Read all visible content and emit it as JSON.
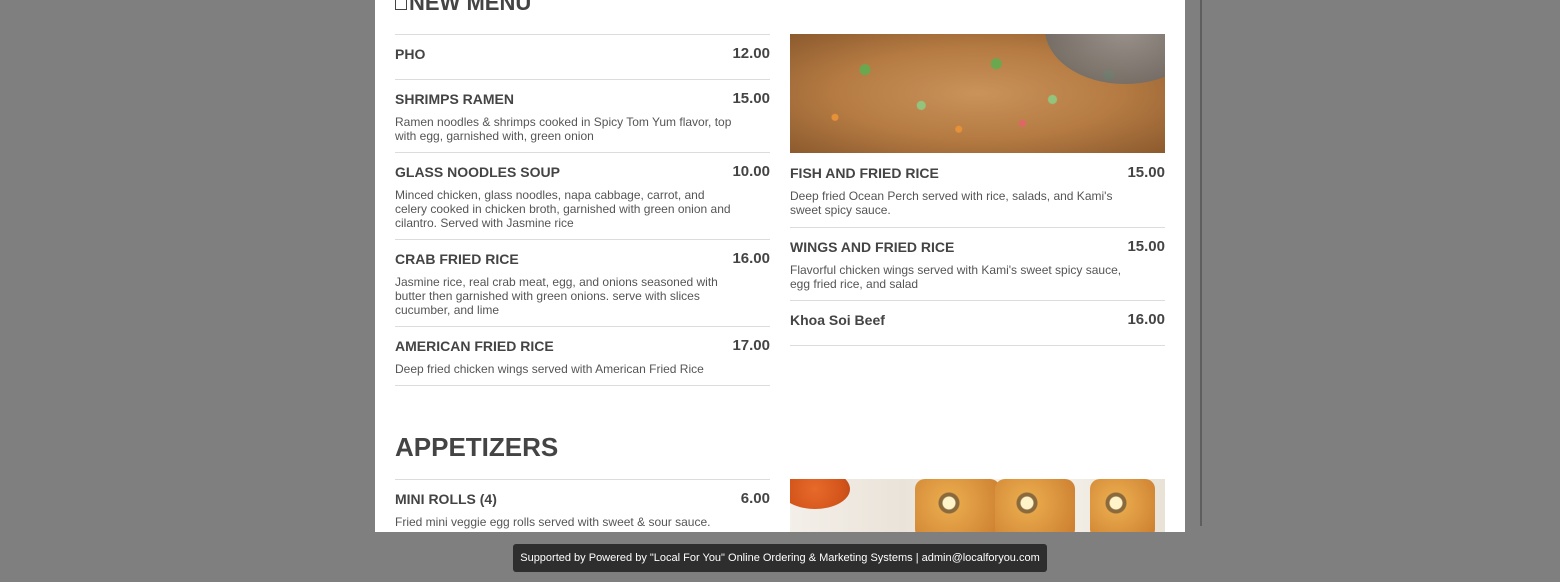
{
  "sections": {
    "new_menu": {
      "title": "NEW MENU",
      "left_items": [
        {
          "name": "PHO",
          "price": "12.00",
          "desc": ""
        },
        {
          "name": "SHRIMPS RAMEN",
          "price": "15.00",
          "desc": "Ramen noodles & shrimps cooked in Spicy Tom Yum flavor, top with egg, garnished with, green onion"
        },
        {
          "name": "GLASS NOODLES SOUP",
          "price": "10.00",
          "desc": "Minced chicken, glass noodles, napa cabbage, carrot, and celery cooked in chicken broth, garnished with green onion and cilantro. Served with Jasmine rice"
        },
        {
          "name": "CRAB FRIED RICE",
          "price": "16.00",
          "desc": "Jasmine rice, real crab meat, egg, and onions seasoned with butter then garnished with green onions. serve with slices cucumber, and lime"
        },
        {
          "name": "AMERICAN FRIED RICE",
          "price": "17.00",
          "desc": "Deep fried chicken wings served with American Fried Rice"
        }
      ],
      "right_items": [
        {
          "name": "FISH AND FRIED RICE",
          "price": "15.00",
          "desc": "Deep fried Ocean Perch served with rice, salads, and Kami's sweet spicy sauce."
        },
        {
          "name": "WINGS AND FRIED RICE",
          "price": "15.00",
          "desc": "Flavorful chicken wings served with Kami's sweet spicy sauce, egg fried rice, and salad"
        },
        {
          "name": "Khoa Soi Beef",
          "price": "16.00",
          "desc": ""
        }
      ]
    },
    "appetizers": {
      "title": "APPETIZERS",
      "left_items": [
        {
          "name": "MINI ROLLS (4)",
          "price": "6.00",
          "desc": "Fried mini veggie egg rolls served with sweet & sour sauce."
        }
      ]
    }
  },
  "footer": {
    "text": "Supported by Powered by \"Local For You\" Online Ordering & Marketing Systems | admin@localforyou.com"
  }
}
